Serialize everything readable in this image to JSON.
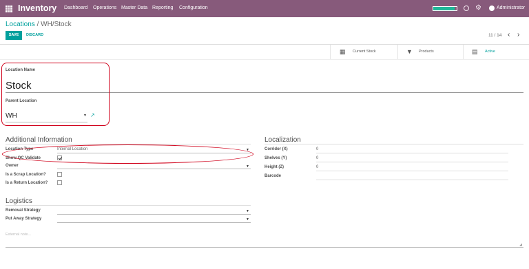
{
  "topbar": {
    "app_name": "Inventory",
    "menu": [
      "Dashboard",
      "Operations",
      "Master Data",
      "Reporting",
      "Configuration"
    ],
    "progress": 0.92,
    "user": "Administrator"
  },
  "breadcrumb": {
    "parent": "Locations",
    "separator": "/",
    "current": "WH/Stock"
  },
  "actions": {
    "save": "SAVE",
    "discard": "DISCARD"
  },
  "pager": {
    "text": "11 / 14"
  },
  "smart_buttons": [
    {
      "label": "Current Stock",
      "icon": "building-icon"
    },
    {
      "label": "Products",
      "icon": "filter-icon"
    },
    {
      "label": "Active",
      "icon": "archive-icon"
    }
  ],
  "form": {
    "location_name_label": "Location Name",
    "location_name": "Stock",
    "parent_location_label": "Parent Location",
    "parent_location": "WH",
    "additional_info": {
      "title": "Additional Information",
      "location_type_label": "Location Type",
      "location_type": "Internal Location",
      "show_qc_label": "Show QC Validate",
      "show_qc_checked": true,
      "owner_label": "Owner",
      "owner": "",
      "scrap_label": "Is a Scrap Location?",
      "scrap_checked": false,
      "return_label": "Is a Return Location?",
      "return_checked": false
    },
    "localization": {
      "title": "Localization",
      "corridor_label": "Corridor (X)",
      "corridor": "0",
      "shelves_label": "Shelves (Y)",
      "shelves": "0",
      "height_label": "Height (Z)",
      "height": "0",
      "barcode_label": "Barcode",
      "barcode": ""
    },
    "logistics": {
      "title": "Logistics",
      "removal_label": "Removal Strategy",
      "removal": "",
      "putaway_label": "Put Away Strategy",
      "putaway": ""
    },
    "note_placeholder": "External note..."
  },
  "colors": {
    "brand": "#875a7b",
    "accent": "#00a09d",
    "highlight": "#d0021b"
  }
}
